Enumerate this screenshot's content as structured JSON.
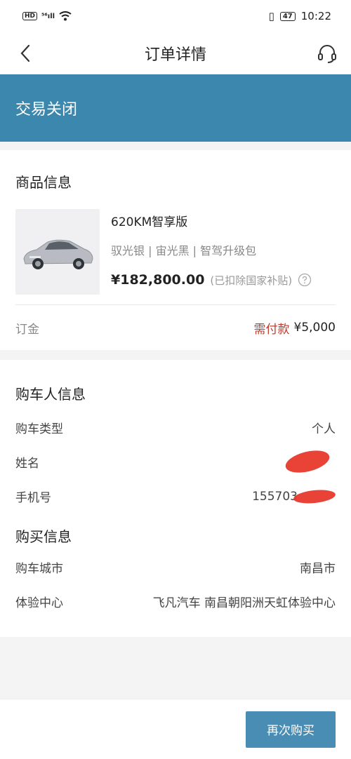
{
  "status_bar": {
    "hd": "HD",
    "signal": "⁵⁶ıll",
    "time": "10:22",
    "battery": "47",
    "vibrate": "▯"
  },
  "nav": {
    "title": "订单详情"
  },
  "banner": {
    "status_text": "交易关闭"
  },
  "goods": {
    "section_title": "商品信息",
    "product_name": "620KM智享版",
    "product_spec": "驭光银 | 宙光黑 | 智驾升级包",
    "price": "¥182,800.00",
    "price_note": "(已扣除国家补贴)",
    "deposit_label": "订金",
    "deposit_status": "需付款",
    "deposit_amount": "¥5,000"
  },
  "buyer": {
    "section_title": "购车人信息",
    "rows": [
      {
        "label": "购车类型",
        "value": "个人"
      },
      {
        "label": "姓名",
        "value": ""
      },
      {
        "label": "手机号",
        "value": "155703"
      }
    ]
  },
  "purchase": {
    "section_title": "购买信息",
    "rows": [
      {
        "label": "购车城市",
        "value": "南昌市"
      },
      {
        "label": "体验中心",
        "value": "飞凡汽车 南昌朝阳洲天虹体验中心"
      }
    ]
  },
  "footer": {
    "rebuy_label": "再次购买"
  },
  "colors": {
    "banner": "#3b87ad",
    "button": "#4a8db4",
    "alert": "#c0392b",
    "redaction": "#e8382c"
  },
  "icons": {
    "back": "chevron-left-icon",
    "support": "headset-icon",
    "help": "question-circle-icon"
  }
}
